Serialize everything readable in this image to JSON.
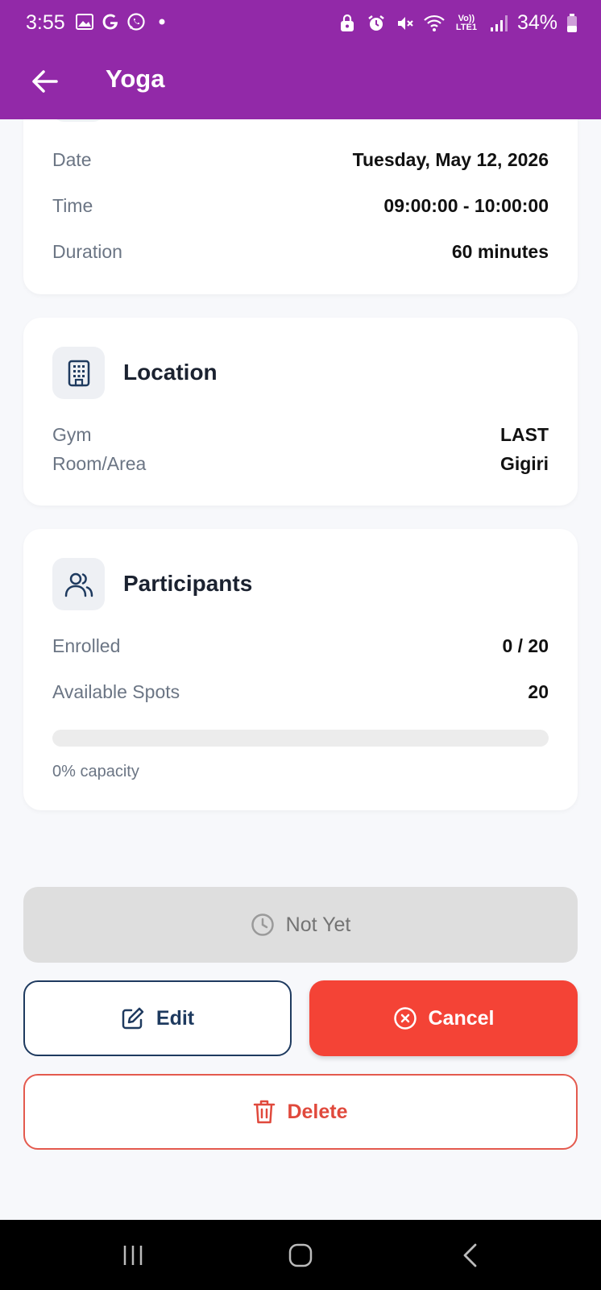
{
  "status": {
    "time": "3:55",
    "left_icons": [
      "gallery-icon",
      "google-icon",
      "whatsapp-icon",
      "dot-icon"
    ],
    "right_icons": [
      "lock-icon",
      "alarm-icon",
      "mute-icon",
      "wifi-icon",
      "volte-icon",
      "signal-icon"
    ],
    "volte_label": "Vo)) LTE1",
    "battery": "34%"
  },
  "appbar": {
    "title": "Yoga"
  },
  "schedule": {
    "rows": [
      {
        "label": "Date",
        "value": "Tuesday, May 12, 2026"
      },
      {
        "label": "Time",
        "value": "09:00:00 - 10:00:00"
      },
      {
        "label": "Duration",
        "value": "60 minutes"
      }
    ]
  },
  "location": {
    "title": "Location",
    "icon": "building-icon",
    "rows": [
      {
        "label": "Gym",
        "value": "LAST"
      },
      {
        "label": "Room/Area",
        "value": "Gigiri"
      }
    ]
  },
  "participants": {
    "title": "Participants",
    "icon": "users-icon",
    "rows": [
      {
        "label": "Enrolled",
        "value": "0 / 20"
      },
      {
        "label": "Available Spots",
        "value": "20"
      }
    ],
    "capacity_fraction": 0,
    "capacity_text": "0% capacity"
  },
  "actions": {
    "status_label": "Not Yet",
    "edit_label": "Edit",
    "cancel_label": "Cancel",
    "delete_label": "Delete"
  },
  "colors": {
    "primary": "#9229a8",
    "cancel": "#f44336",
    "delete": "#e0493c",
    "edit_outline": "#1e3a5f"
  }
}
